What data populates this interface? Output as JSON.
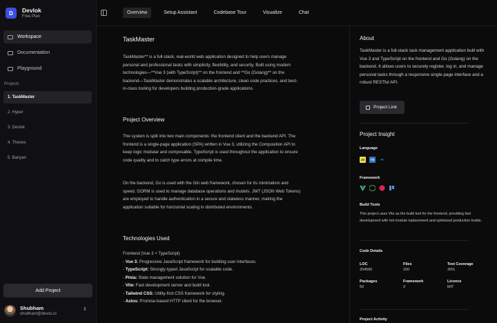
{
  "app": {
    "name": "Devlok",
    "plan": "Free Plan",
    "logo_letter": "D",
    "accent": "#3b4fe0"
  },
  "sidebar": {
    "nav": [
      {
        "label": "Workspace",
        "active": true
      },
      {
        "label": "Documentation",
        "active": false
      },
      {
        "label": "Playground",
        "active": false
      }
    ],
    "projects_heading": "Projects",
    "projects": [
      {
        "label": "1. TaskMaster",
        "active": true
      },
      {
        "label": "2. Hyper",
        "active": false
      },
      {
        "label": "3. Devlok",
        "active": false
      },
      {
        "label": "4. Thenex",
        "active": false
      },
      {
        "label": "5. Banyan",
        "active": false
      }
    ],
    "add_project": "Add Project",
    "user": {
      "name": "Shubham",
      "email": "shubham@devss.io"
    }
  },
  "tabs": [
    {
      "label": "Overview",
      "active": true
    },
    {
      "label": "Setup Assistant",
      "active": false
    },
    {
      "label": "Codebase Tour",
      "active": false
    },
    {
      "label": "Visualize",
      "active": false
    },
    {
      "label": "Chat",
      "active": false
    }
  ],
  "main": {
    "title": "TaskMaster",
    "intro": "TaskMaster** is a full-stack, real-world web application designed to help users manage personal and professional tasks with simplicity, flexibility, and security. Built using modern technologies—**Vue 3 (with TypeScript)** on the frontend and **Go (Golang)** on the backend—TaskMaster demonstrates a scalable architecture, clean code practices, and best-in-class tooling for developers building production-grade applications.",
    "overview_heading": "Project Overview",
    "overview_p1": "The system is split into two main components: the frontend client and the backend API. The frontend is a single-page application (SPA) written in Vue 3, utilizing the Composition API to keep logic modular and composable. TypeScript is used throughout the application to ensure code quality and to catch type errors at compile time.",
    "overview_p2": "On the backend, Go is used with the Gin web framework, chosen for its minimalism and speed. GORM is used to manage database operations and models. JWT (JSON Web Tokens) are employed to handle authentication in a secure and stateless manner, making the application suitable for horizontal scaling in distributed environments.",
    "tech_heading": "Technologies Used",
    "tech_intro": "Frontend (Vue 3 + TypeScript)",
    "tech_items": [
      {
        "name": "Vue 3:",
        "desc": " Progressive JavaScript framework for building user interfaces."
      },
      {
        "name": "TypeScript:",
        "desc": " Strongly-typed JavaScript for scalable code."
      },
      {
        "name": "Pinia:",
        "desc": " State management solution for Vue."
      },
      {
        "name": "Vite:",
        "desc": " Fast development server and build tool."
      },
      {
        "name": "Tailwind CSS:",
        "desc": " Utility-first CSS framework for styling."
      },
      {
        "name": "Axios:",
        "desc": " Promise-based HTTP client for the browser."
      }
    ]
  },
  "right": {
    "about_heading": "About",
    "about_text": "TaskMaster is a full-stack task management application built with Vue 3 and TypeScript on the frontend and Go (Golang) on the backend. It allows users to securely register, log in, and manage personal tasks through a responsive single-page interface and a robust RESTful API.",
    "project_link": "Project Link",
    "insight_heading": "Project Insight",
    "language_label": "Language",
    "language_icons": [
      "javascript-icon",
      "typescript-icon",
      "go-icon"
    ],
    "framework_label": "Framework",
    "framework_icons": [
      "vue-icon",
      "node-icon",
      "nest-icon",
      "laravel-icon"
    ],
    "build_tools_label": "Build Tools",
    "build_tools_text": "This project uses Vite as the build tool for the frontend, providing fast development with hot module replacement and optimized production builds.",
    "code_details_label": "Code Details",
    "code_details": [
      {
        "key": "LOC",
        "value": "204566"
      },
      {
        "key": "Files",
        "value": "200"
      },
      {
        "key": "Test Coverage",
        "value": "30%"
      },
      {
        "key": "Packages",
        "value": "50"
      },
      {
        "key": "Framework",
        "value": "3"
      },
      {
        "key": "Licence",
        "value": "MIT"
      }
    ],
    "activity_label": "Project Activity"
  }
}
